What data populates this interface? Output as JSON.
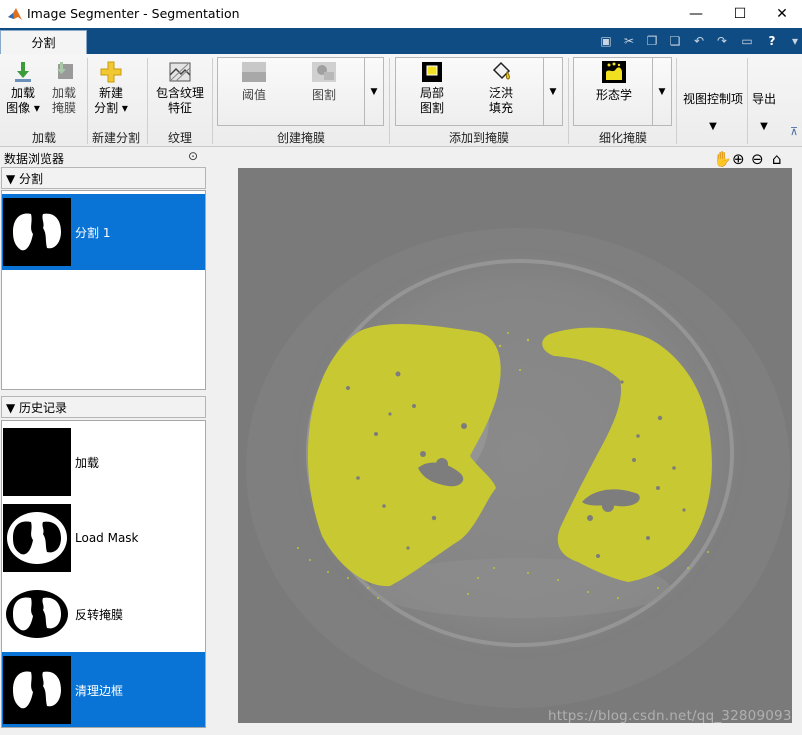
{
  "window": {
    "title": "Image Segmenter - Segmentation",
    "minimize_glyph": "—",
    "maximize_glyph": "☐",
    "close_glyph": "✕"
  },
  "tabs": [
    {
      "label": "分割"
    }
  ],
  "quick_access": {
    "icons": [
      "save-icon",
      "cut-icon",
      "copy-icon",
      "paste-icon",
      "undo-icon",
      "redo-icon",
      "layout-icon",
      "help-icon",
      "expand-icon"
    ],
    "glyphs": [
      "▣",
      "✂",
      "❐",
      "❏",
      "↶",
      "↷",
      "▭",
      "?",
      "▾"
    ]
  },
  "ribbon": {
    "load_image": {
      "line1": "加载",
      "line2": "图像 ▾"
    },
    "load_mask": {
      "line1": "加载",
      "line2": "掩膜"
    },
    "new_segmentation": {
      "line1": "新建",
      "line2": "分割 ▾"
    },
    "texture": {
      "line1": "包含纹理",
      "line2": "特征"
    },
    "threshold": "阈值",
    "graph_cut": "图割",
    "local_graph_cut": {
      "line1": "局部",
      "line2": "图割"
    },
    "flood_fill": {
      "line1": "泛洪",
      "line2": "填充"
    },
    "morphology": "形态学",
    "view_controls": "视图控制项",
    "export": "导出",
    "gallery_arrow": "▼",
    "big_arrow": "▼",
    "collapse": "⊼",
    "groups": {
      "load": "加载",
      "new_seg": "新建分割",
      "texture": "纹理",
      "create_mask": "创建掩膜",
      "add_to_mask": "添加到掩膜",
      "refine_mask": "细化掩膜"
    }
  },
  "browser": {
    "title": "数据浏览器",
    "menu_glyph": "⊙",
    "segmentation": {
      "header": "▼ 分割",
      "items": [
        {
          "label": "分割 1"
        }
      ]
    },
    "history": {
      "header": "▼ 历史记录",
      "items": [
        {
          "label": "加载"
        },
        {
          "label": "Load Mask"
        },
        {
          "label": "反转掩膜"
        },
        {
          "label": "清理边框"
        }
      ]
    }
  },
  "viewer_tools": [
    "pan-icon",
    "zoom-in-icon",
    "zoom-out-icon",
    "home-icon"
  ],
  "viewer_glyphs": [
    "✋",
    "⊕",
    "⊖",
    "⌂"
  ],
  "overlay_color": "#c8c832",
  "accent": "#0a74d6",
  "watermark": "https://blog.csdn.net/qq_32809093"
}
